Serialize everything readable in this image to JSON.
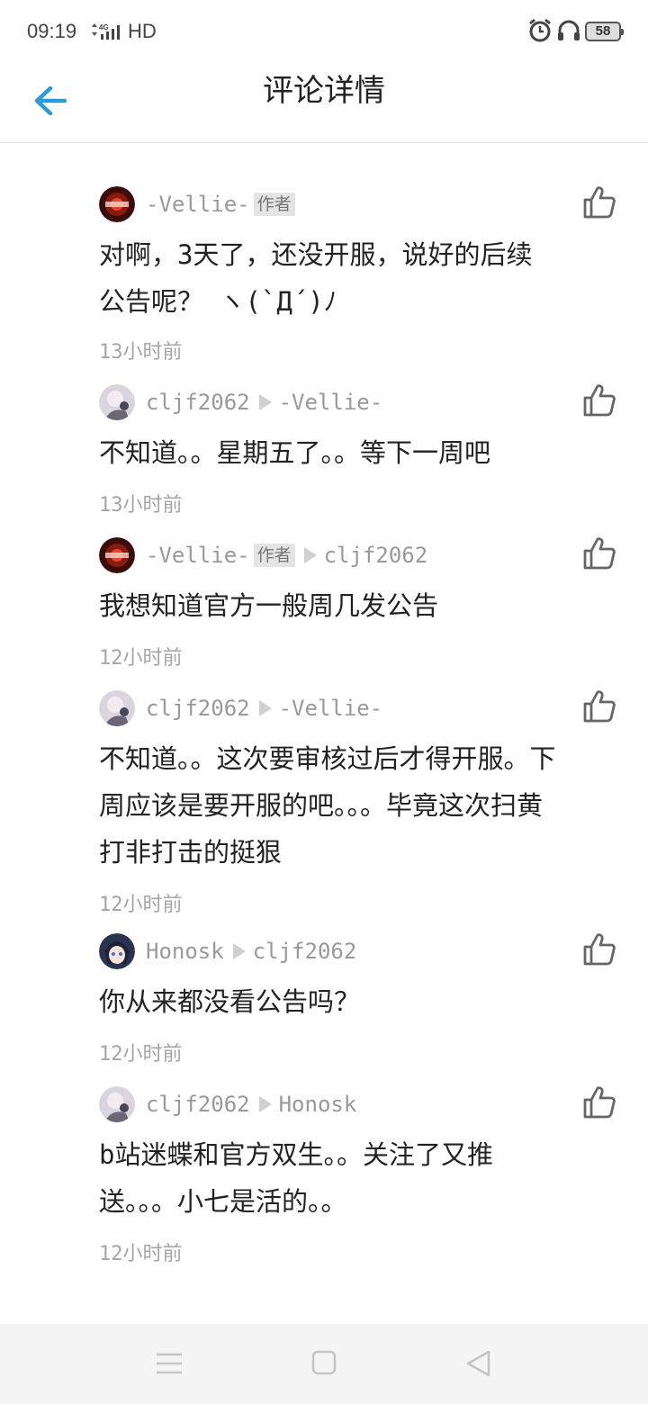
{
  "status_bar": {
    "time": "09:19",
    "network": "4G",
    "hd": "HD",
    "battery": "58"
  },
  "header": {
    "back_icon": "arrow-left-icon",
    "title": "评论详情",
    "accent_color": "#2b9bd8"
  },
  "clipped_text": "· · ·",
  "comments": [
    {
      "user": "-Vellie-",
      "author_badge": "作者",
      "reply_to": "",
      "text": "对啊，3天了，还没开服，说好的后续公告呢？ ヽ(`Д´)ﾉ",
      "time": "13小时前"
    },
    {
      "user": "cljf2062",
      "author_badge": "",
      "reply_to": "-Vellie-",
      "text": "不知道。。星期五了。。等下一周吧",
      "time": "13小时前"
    },
    {
      "user": "-Vellie-",
      "author_badge": "作者",
      "reply_to": "cljf2062",
      "text": "我想知道官方一般周几发公告",
      "time": "12小时前"
    },
    {
      "user": "cljf2062",
      "author_badge": "",
      "reply_to": "-Vellie-",
      "text": "不知道。。这次要审核过后才得开服。下周应该是要开服的吧。。。毕竟这次扫黄打非打击的挺狠",
      "time": "12小时前"
    },
    {
      "user": "Honosk",
      "author_badge": "",
      "reply_to": "cljf2062",
      "text": "你从来都没看公告吗？",
      "time": "12小时前"
    },
    {
      "user": "cljf2062",
      "author_badge": "",
      "reply_to": "Honosk",
      "text": "b站迷蝶和官方双生。。关注了又推送。。。小七是活的。。",
      "time": "12小时前"
    }
  ],
  "nav_bar": {
    "menu_icon": "menu-icon",
    "home_icon": "home-square-icon",
    "back_icon": "back-triangle-icon"
  }
}
